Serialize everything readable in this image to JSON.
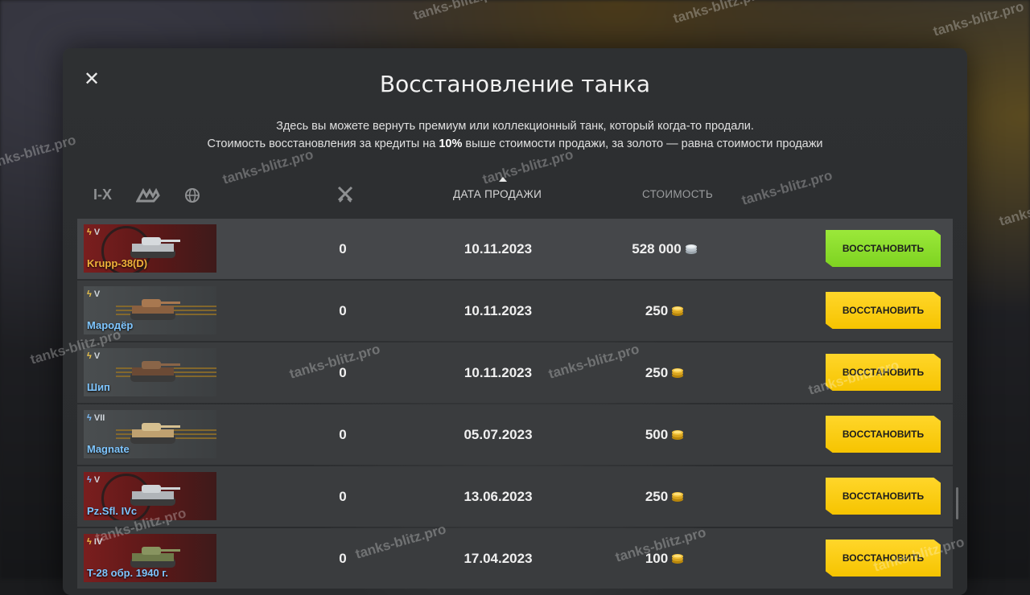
{
  "dialog": {
    "title": "Восстановление танка",
    "desc_line1": "Здесь вы можете вернуть премиум или коллекционный танк, который когда-то продали.",
    "desc_line2_pre": "Стоимость восстановления за кредиты на ",
    "desc_line2_bold": "10%",
    "desc_line2_post": " выше стоимости продажи, за золото — равна стоимости продажи"
  },
  "filters": {
    "tier_label": "I-X"
  },
  "columns": {
    "sale_date": "ДАТА ПРОДАЖИ",
    "cost": "СТОИМОСТЬ"
  },
  "colors": {
    "accent_green": "#7ed321",
    "accent_yellow": "#f6c400"
  },
  "rows": [
    {
      "tier": "V",
      "name": "Krupp-38(D)",
      "count": "0",
      "date": "10.11.2023",
      "cost": "528 000",
      "currency": "credits-icon",
      "button": "ВОССТАНОВИТЬ"
    },
    {
      "tier": "V",
      "name": "Мародёр",
      "count": "0",
      "date": "10.11.2023",
      "cost": "250",
      "currency": "gold-icon",
      "button": "ВОССТАНОВИТЬ"
    },
    {
      "tier": "V",
      "name": "Шип",
      "count": "0",
      "date": "10.11.2023",
      "cost": "250",
      "currency": "gold-icon",
      "button": "ВОССТАНОВИТЬ"
    },
    {
      "tier": "VII",
      "name": "Magnate",
      "count": "0",
      "date": "05.07.2023",
      "cost": "500",
      "currency": "gold-icon",
      "button": "ВОССТАНОВИТЬ"
    },
    {
      "tier": "V",
      "name": "Pz.Sfl. IVc",
      "count": "0",
      "date": "13.06.2023",
      "cost": "250",
      "currency": "gold-icon",
      "button": "ВОССТАНОВИТЬ"
    },
    {
      "tier": "IV",
      "name": "T-28 обр. 1940 г.",
      "count": "0",
      "date": "17.04.2023",
      "cost": "100",
      "currency": "gold-icon",
      "button": "ВОССТАНОВИТЬ"
    }
  ],
  "watermark": "tanks-blitz.pro"
}
